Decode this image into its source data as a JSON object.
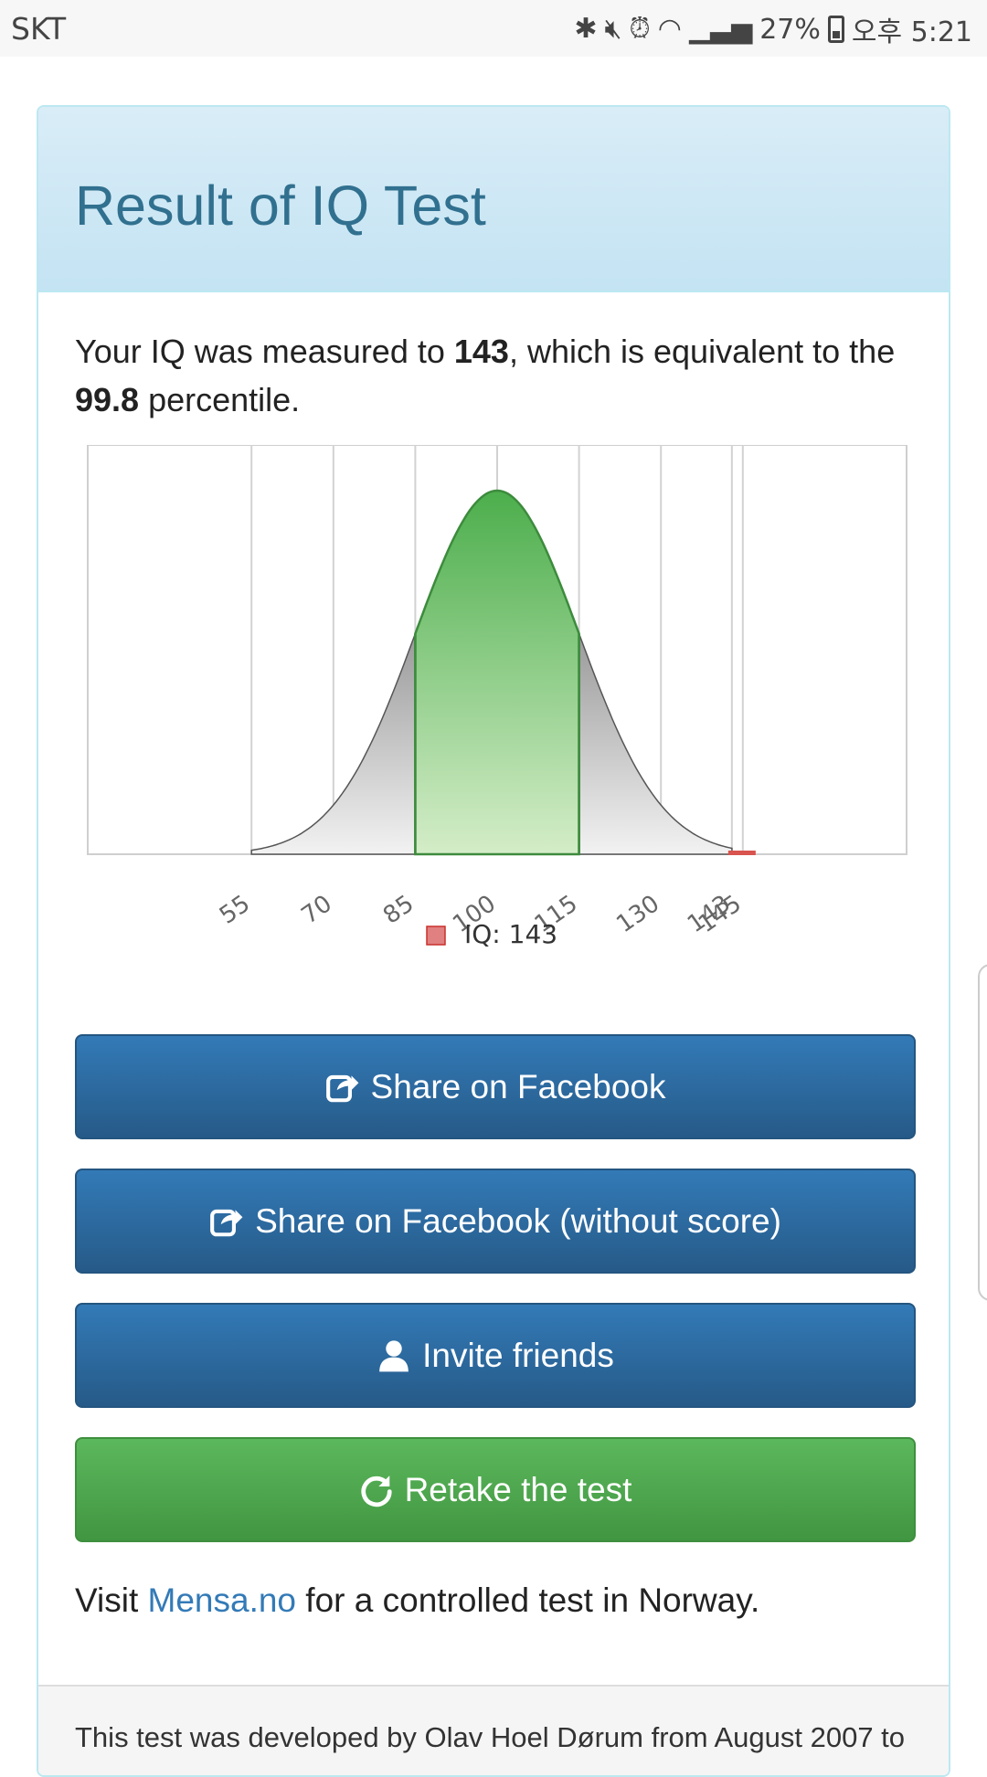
{
  "status_bar": {
    "carrier": "SKT",
    "battery": "27%",
    "time": "오후 5:21",
    "icons": [
      "bluetooth-icon",
      "mute-icon",
      "alarm-icon",
      "wifi-icon",
      "signal-icon",
      "battery-icon"
    ]
  },
  "panel": {
    "title": "Result of IQ Test",
    "result": {
      "prefix": "Your IQ was measured to ",
      "iq": "143",
      "middle": ", which is equivalent to the ",
      "percentile": "99.8",
      "suffix": " percentile."
    }
  },
  "chart_data": {
    "type": "area",
    "title": "",
    "xlabel": "",
    "ylabel": "",
    "distribution": "normal",
    "mean": 100,
    "sd": 15,
    "xlim": [
      25,
      175
    ],
    "x_ticks": [
      55,
      70,
      85,
      100,
      115,
      130,
      143,
      145
    ],
    "highlighted_range": [
      85,
      115
    ],
    "score": 143,
    "legend": [
      {
        "label": "IQ: 143",
        "color": "#d9534f"
      }
    ],
    "colors": {
      "highlight": "#5cb85c",
      "tail": "#cccccc",
      "marker": "#d9534f"
    },
    "grid": true
  },
  "buttons": {
    "share": {
      "label": "Share on Facebook",
      "icon": "share-icon"
    },
    "share_no_score": {
      "label": "Share on Facebook (without score)",
      "icon": "share-icon"
    },
    "invite": {
      "label": "Invite friends",
      "icon": "user-icon"
    },
    "retake": {
      "label": "Retake the test",
      "icon": "refresh-icon"
    }
  },
  "visit": {
    "prefix": "Visit ",
    "link": "Mensa.no",
    "suffix": " for a controlled test in Norway."
  },
  "footer": {
    "text": "This test was developed by Olav Hoel Dørum from August 2007 to"
  },
  "colors": {
    "heading_bg": "#d9edf7",
    "heading_text": "#31708f",
    "primary": "#337ab7",
    "success": "#5cb85c"
  }
}
